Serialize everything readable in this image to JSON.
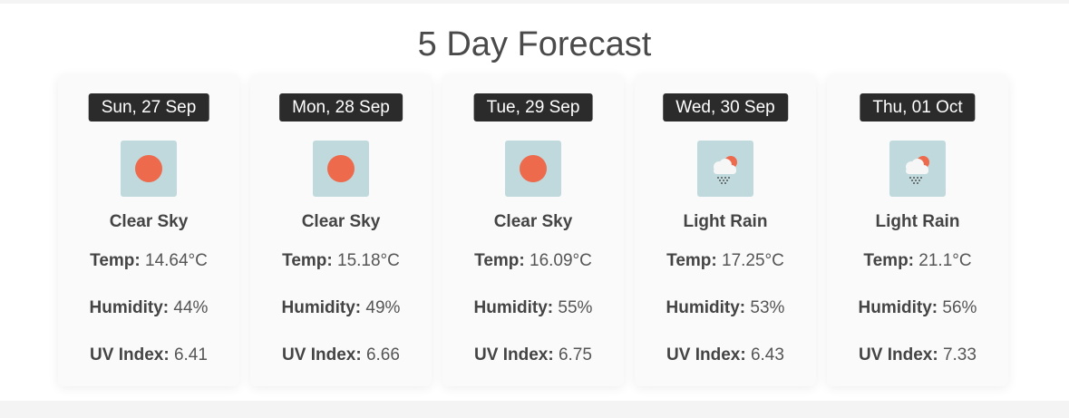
{
  "title": "5 Day Forecast",
  "labels": {
    "temp": "Temp:",
    "humidity": "Humidity:",
    "uv": "UV Index:"
  },
  "colors": {
    "date_bg": "#2b2b2b",
    "icon_bg": "#bfd9dd",
    "sun": "#ee6a4c"
  },
  "days": [
    {
      "date": "Sun, 27 Sep",
      "icon": "clear-sky-icon",
      "condition": "Clear Sky",
      "temp": "14.64°C",
      "humidity": "44%",
      "uv": "6.41"
    },
    {
      "date": "Mon, 28 Sep",
      "icon": "clear-sky-icon",
      "condition": "Clear Sky",
      "temp": "15.18°C",
      "humidity": "49%",
      "uv": "6.66"
    },
    {
      "date": "Tue, 29 Sep",
      "icon": "clear-sky-icon",
      "condition": "Clear Sky",
      "temp": "16.09°C",
      "humidity": "55%",
      "uv": "6.75"
    },
    {
      "date": "Wed, 30 Sep",
      "icon": "light-rain-icon",
      "condition": "Light Rain",
      "temp": "17.25°C",
      "humidity": "53%",
      "uv": "6.43"
    },
    {
      "date": "Thu, 01 Oct",
      "icon": "light-rain-icon",
      "condition": "Light Rain",
      "temp": "21.1°C",
      "humidity": "56%",
      "uv": "7.33"
    }
  ]
}
